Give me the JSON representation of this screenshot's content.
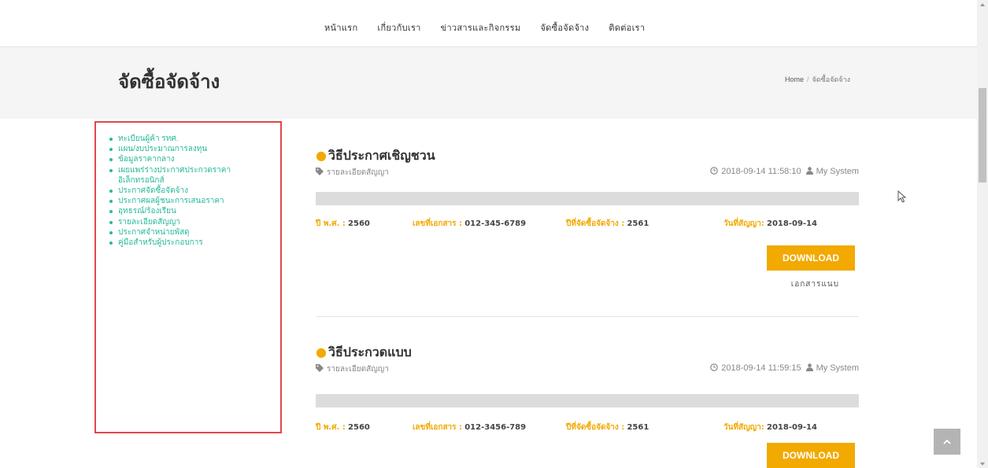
{
  "nav": {
    "items": [
      "หน้าแรก",
      "เกี่ยวกับเรา",
      "ข่าวสารและกิจกรรม",
      "จัดซื้อจัดจ้าง",
      "ติดต่อเรา"
    ]
  },
  "page": {
    "title": "จัดซื้อจัดจ้าง",
    "breadcrumb": {
      "home": "Home",
      "separator": "/",
      "current": "จัดซื้อจัดจ้าง"
    }
  },
  "sidebar": {
    "items": [
      "ทะเบียนผู้ค้า รทศ.",
      "แผน/งบประมาณการลงทุน",
      "ข้อมูลราคากลาง",
      "เผยแพร่ร่างประกาศประกวดราคาอิเล็กทรอนิกส์",
      "ประกาศจัดซื้อจัดจ้าง",
      "ประกาศผลผู้ชนะการเสนอราคา",
      "อุทธรณ์/ร้องเรียน",
      "รายละเอียดสัญญา",
      "ประกาศจำหน่ายพัสดุ",
      "คู่มือสำหรับผู้ประกอบการ"
    ]
  },
  "posts": [
    {
      "title": "วิธีประกาศเชิญชวน",
      "category": "รายละเอียดสัญญา",
      "datetime": "2018-09-14 11:58:10",
      "author": "My System",
      "fields": {
        "year": {
          "label": "ปี พ.ศ. :",
          "value": "2560"
        },
        "doc_no": {
          "label": "เลขที่เอกสาร :",
          "value": "012-345-6789"
        },
        "proc_year": {
          "label": "ปีที่จัดซื้อจัดจ้าง :",
          "value": "2561"
        },
        "contract_date": {
          "label": "วันที่สัญญา:",
          "value": "2018-09-14"
        }
      },
      "download_label": "DOWNLOAD",
      "doc_type": "เอกสารแนบ"
    },
    {
      "title": "วิธีประกวดแบบ",
      "category": "รายละเอียดสัญญา",
      "datetime": "2018-09-14 11:59:15",
      "author": "My System",
      "fields": {
        "year": {
          "label": "ปี พ.ศ. :",
          "value": "2560"
        },
        "doc_no": {
          "label": "เลขที่เอกสาร :",
          "value": "012-3456-789"
        },
        "proc_year": {
          "label": "ปีที่จัดซื้อจัดจ้าง :",
          "value": "2561"
        },
        "contract_date": {
          "label": "วันที่สัญญา:",
          "value": "2018-09-14"
        }
      },
      "download_label": "DOWNLOAD"
    }
  ],
  "colors": {
    "accent": "#f2a900",
    "link": "#27b99a",
    "highlight_border": "#e0474c"
  }
}
